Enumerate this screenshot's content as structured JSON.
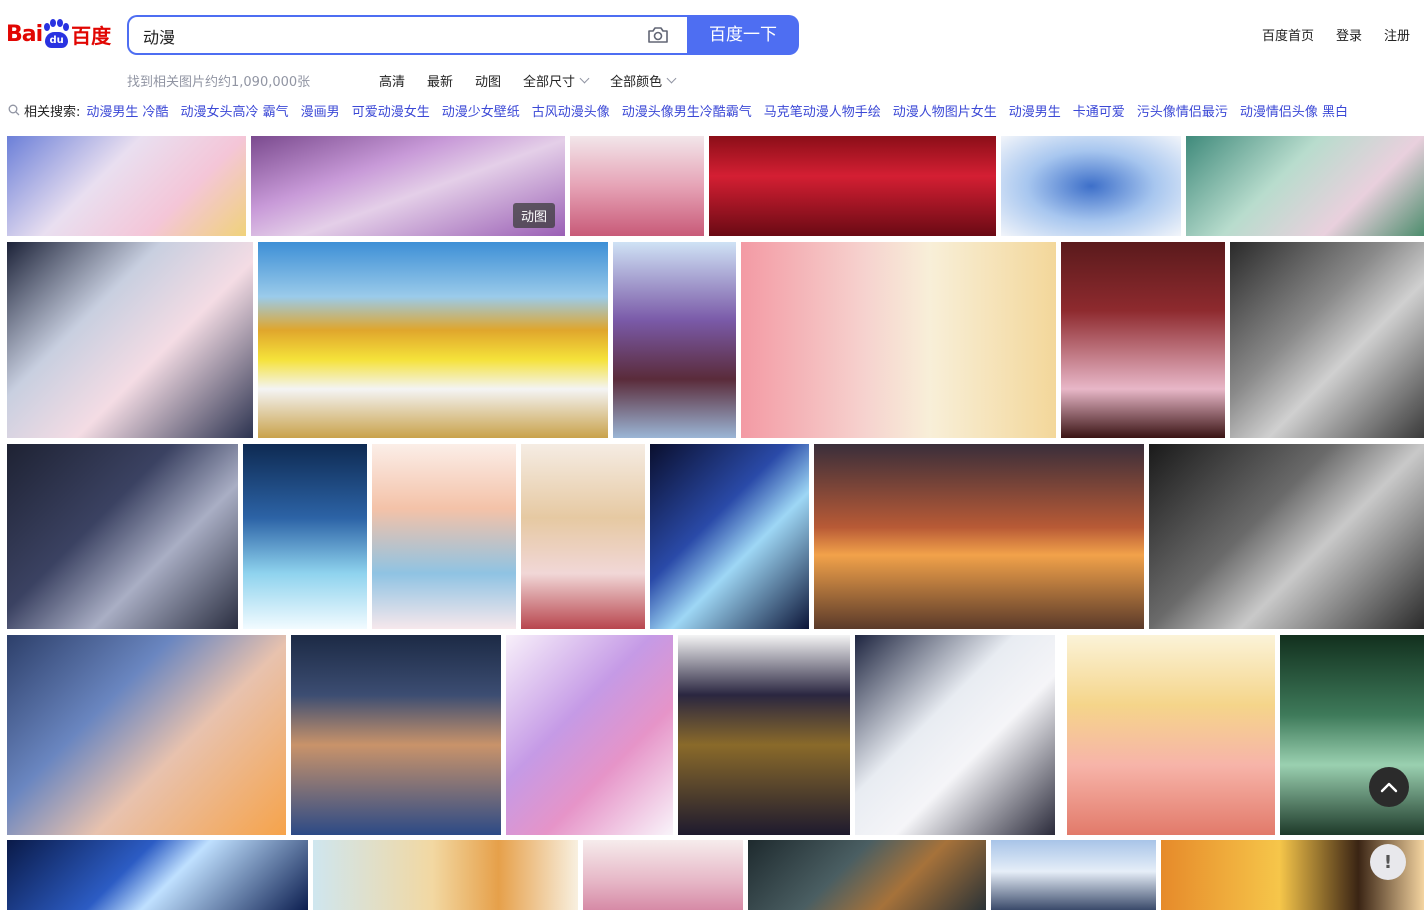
{
  "logo": {
    "bai": "Bai",
    "du": "du",
    "cn": "百度"
  },
  "search": {
    "query": "动漫",
    "button": "百度一下"
  },
  "nav": {
    "home": "百度首页",
    "login": "登录",
    "register": "注册"
  },
  "results": {
    "count": "找到相关图片约约1,090,000张"
  },
  "filters": [
    "高清",
    "最新",
    "动图",
    "全部尺寸",
    "全部颜色"
  ],
  "related": {
    "label": "相关搜索:",
    "items": [
      "动漫男生 冷酷",
      "动漫女头高冷 霸气",
      "漫画男",
      "可爱动漫女生",
      "动漫少女壁纸",
      "古风动漫头像",
      "动漫头像男生冷酷霸气",
      "马克笔动漫人物手绘",
      "动漫人物图片女生",
      "动漫男生",
      "卡通可爱",
      "污头像情侣最污",
      "动漫情侣头像 黑白"
    ]
  },
  "badge": {
    "gif": "动图"
  },
  "feedback": {
    "label": "!"
  },
  "colors": {
    "brand_blue": "#4e6ef2",
    "brand_red": "#e10602",
    "link": "#3b48d6"
  }
}
